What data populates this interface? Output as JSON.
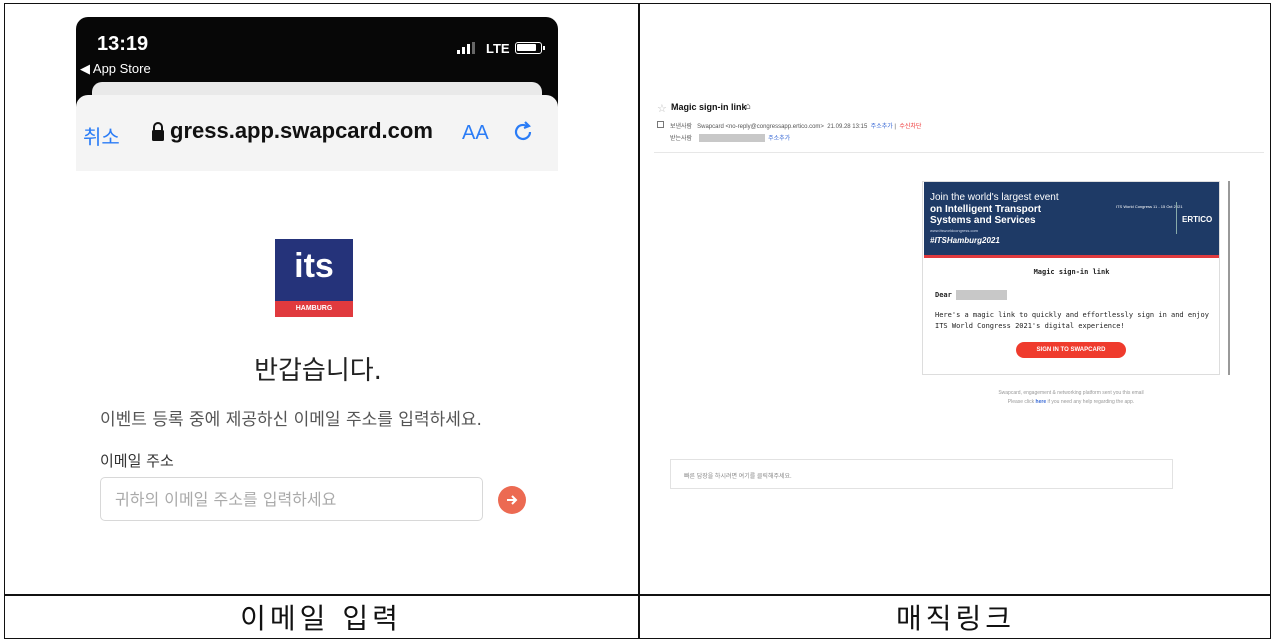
{
  "left": {
    "status": {
      "time": "13:19",
      "back_app": "◀ App Store",
      "network": "LTE"
    },
    "urlbar": {
      "cancel": "취소",
      "url": "gress.app.swapcard.com",
      "aa": "AA"
    },
    "logo": {
      "text": "its",
      "band": "HAMBURG"
    },
    "welcome": "반갑습니다.",
    "instruction": "이벤트 등록 중에 제공하신 이메일 주소를 입력하세요.",
    "email_label": "이메일 주소",
    "email_placeholder": "귀하의 이메일 주소를 입력하세요",
    "caption": "이메일 입력"
  },
  "right": {
    "subject": "Magic sign-in link",
    "sender_label": "보낸사람",
    "sender": "Swapcard <no-reply@congressapp.ertico.com>",
    "date": "21.09.28 13:15",
    "add_address": "주소추가",
    "block": "수신차단",
    "recipient_label": "받는사람",
    "recipient_add": "주소추가",
    "banner": {
      "line1": "Join the world's largest event",
      "line2": "on Intelligent Transport",
      "line3": "Systems and Services",
      "url": "www.itsworldcongress.com",
      "hashtag": "#ITSHamburg2021",
      "congress": "ITS World Congress 11 - 15 Oct 2021",
      "ertico": "ERTICO"
    },
    "mail_title": "Magic sign-in link",
    "dear": "Dear",
    "body": "Here's a magic link to quickly and effortlessly sign in and enjoy ITS World Congress 2021's digital experience!",
    "button": "SIGN IN TO SWAPCARD",
    "footer1": "Swapcard, engagement & networking platform sent you this email",
    "footer2_pre": "Please click ",
    "footer2_link": "here",
    "footer2_post": " if you need any help regarding the app.",
    "reply_placeholder": "빠른 답장을 하시려면 여기를 클릭해주세요.",
    "caption": "매직링크"
  }
}
